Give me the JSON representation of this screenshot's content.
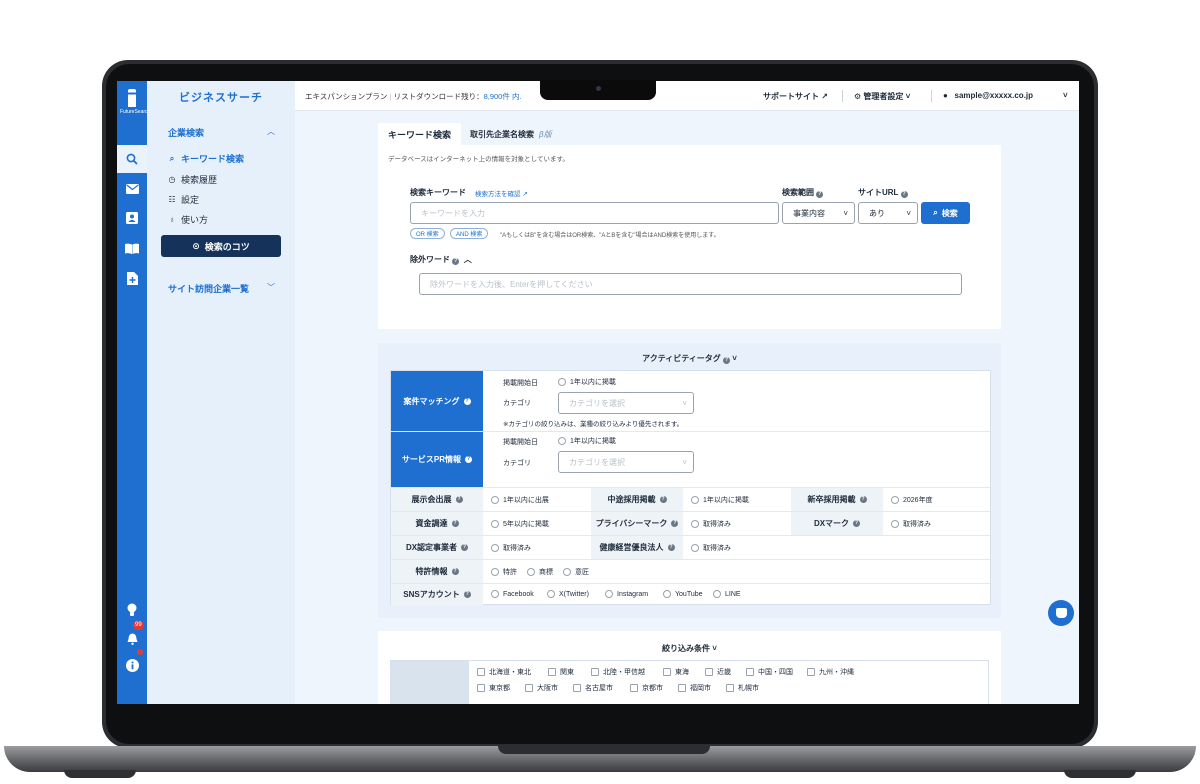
{
  "brand": {
    "logo_text": "FutureSearch",
    "title": "ビジネスサーチ"
  },
  "rail": {
    "notification_count": "99"
  },
  "sidebar": {
    "company_search": "企業検索",
    "items": [
      {
        "icon": "search-icon",
        "label": "キーワード検索",
        "active": true
      },
      {
        "icon": "history-icon",
        "label": "検索履歴"
      },
      {
        "icon": "sliders-icon",
        "label": "設定"
      },
      {
        "icon": "lightbulb-icon",
        "label": "使い方"
      }
    ],
    "tips_button": "検索のコツ",
    "site_visit": "サイト訪問企業一覧"
  },
  "topbar": {
    "plan": "エキスパンションプラン",
    "download_label": "リストダウンロード残り：",
    "download_value": "8,900件",
    "download_suffix": "内.",
    "support": "サポートサイト",
    "admin": "管理者設定",
    "user_email": "sample@xxxxx.co.jp"
  },
  "tabs": {
    "keyword": "キーワード検索",
    "partner": "取引先企業名検索",
    "beta": "β版"
  },
  "search": {
    "note": "データベースはインターネット上の情報を対象としています。",
    "keyword_label": "検索キーワード",
    "how_to_link": "検索方法を確認",
    "keyword_placeholder": "キーワードを入力",
    "scope_label": "検索範囲",
    "scope_value": "事業内容",
    "url_label": "サイトURL",
    "url_value": "あり",
    "search_button": "検索",
    "or_pill": "OR 検索",
    "and_pill": "AND 検索",
    "hint": "\"AもしくはB\"を含む場合はOR検索、\"AとBを含む\"場合はAND検索を使用します。",
    "exclude_label": "除外ワード",
    "exclude_placeholder": "除外ワードを入力後、Enterを押してください"
  },
  "activity": {
    "title": "アクティビティータグ",
    "matching": {
      "header": "案件マッチング",
      "start_label": "掲載開始日",
      "start_option": "1年以内に掲載",
      "category_label": "カテゴリ",
      "category_placeholder": "カテゴリを選択",
      "note": "※カテゴリの絞り込みは、業種の絞り込みより優先されます。"
    },
    "service_pr": {
      "header": "サービスPR情報",
      "start_label": "掲載開始日",
      "start_option": "1年以内に掲載",
      "category_label": "カテゴリ",
      "category_placeholder": "カテゴリを選択"
    },
    "rows": {
      "expo": {
        "label": "展示会出展",
        "option": "1年以内に出展"
      },
      "midcareer": {
        "label": "中途採用掲載",
        "option": "1年以内に掲載"
      },
      "newgrad": {
        "label": "新卒採用掲載",
        "option": "2026年度"
      },
      "funding": {
        "label": "資金調達",
        "option": "5年以内に掲載"
      },
      "privacy": {
        "label": "プライバシーマーク",
        "option": "取得済み"
      },
      "dx_mark": {
        "label": "DXマーク",
        "option": "取得済み"
      },
      "dx_cert": {
        "label": "DX認定事業者",
        "option": "取得済み"
      },
      "health": {
        "label": "健康経営優良法人",
        "option": "取得済み"
      },
      "patent": {
        "label": "特許情報",
        "options": [
          "特許",
          "商標",
          "意匠"
        ]
      },
      "sns": {
        "label": "SNSアカウント",
        "options": [
          "Facebook",
          "X(Twitter)",
          "Instagram",
          "YouTube",
          "LINE"
        ]
      }
    }
  },
  "filters": {
    "title": "絞り込み条件",
    "regions": [
      "北海道・東北",
      "関東",
      "北陸・甲信越",
      "東海",
      "近畿",
      "中国・四国",
      "九州・沖縄"
    ],
    "cities": [
      "東京都",
      "大阪市",
      "名古屋市",
      "京都市",
      "福岡市",
      "札幌市"
    ]
  }
}
